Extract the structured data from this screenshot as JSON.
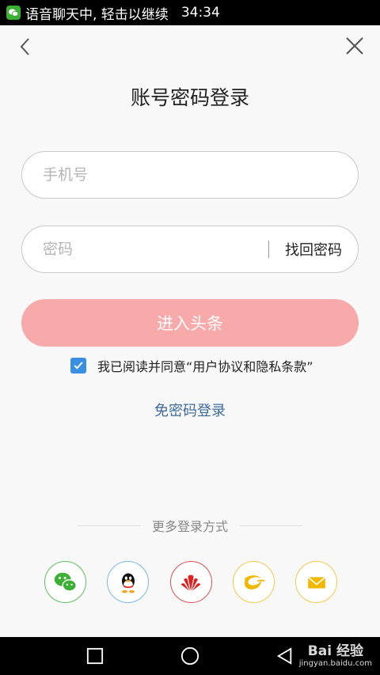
{
  "status_bar": {
    "text": "语音聊天中, 轻击以继续",
    "time": "34:34",
    "icon": "wechat-icon"
  },
  "nav": {
    "back_icon": "chevron-left-icon",
    "close_icon": "close-icon"
  },
  "title": "账号密码登录",
  "phone": {
    "placeholder": "手机号",
    "value": ""
  },
  "password": {
    "placeholder": "密码",
    "value": "",
    "recover_label": "找回密码"
  },
  "submit_label": "进入头条",
  "agreement": {
    "checked": true,
    "text": "我已阅读并同意“用户协议和隐私条款”"
  },
  "no_password_login": "免密码登录",
  "more_login": "更多登录方式",
  "social": [
    {
      "name": "wechat-icon",
      "color": "#3cb034"
    },
    {
      "name": "qq-icon",
      "color": "#000000"
    },
    {
      "name": "huawei-icon",
      "color": "#e02020"
    },
    {
      "name": "tianyi-icon",
      "color": "#f2b800"
    },
    {
      "name": "mail-icon",
      "color": "#f2b800"
    }
  ],
  "watermark": {
    "main": "Bai 经验",
    "sub": "jingyan.baidu.com"
  }
}
